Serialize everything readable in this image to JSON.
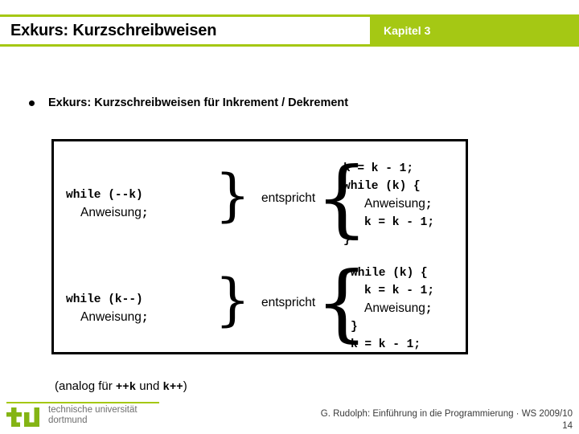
{
  "header": {
    "title": "Exkurs: Kurzschreibweisen",
    "chapter": "Kapitel 3",
    "accent_color": "#a5c814"
  },
  "bullet": {
    "marker": "bullet-dot",
    "text": "Exkurs: Kurzschreibweisen für Inkrement / Dekrement"
  },
  "equivalences": [
    {
      "left": {
        "lines": [
          {
            "text": "while (--k)",
            "style": "mono",
            "indent": 0
          },
          {
            "text": "Anweisung",
            "style": "sans",
            "indent": 1,
            "suffix": ";"
          }
        ]
      },
      "connector": "entspricht",
      "right": {
        "lines": [
          {
            "text": "k = k - 1;",
            "style": "mono",
            "indent": 0
          },
          {
            "text": "while (k) {",
            "style": "mono",
            "indent": 0
          },
          {
            "text": "Anweisung",
            "style": "sans",
            "indent": 1,
            "suffix": ";"
          },
          {
            "text": "k = k - 1;",
            "style": "mono",
            "indent": 1
          },
          {
            "text": "}",
            "style": "mono",
            "indent": 0
          }
        ]
      }
    },
    {
      "left": {
        "lines": [
          {
            "text": "while (k--)",
            "style": "mono",
            "indent": 0
          },
          {
            "text": "Anweisung",
            "style": "sans",
            "indent": 1,
            "suffix": ";"
          }
        ]
      },
      "connector": "entspricht",
      "right": {
        "lines": [
          {
            "text": "while (k) {",
            "style": "mono",
            "indent": 0
          },
          {
            "text": "k = k - 1;",
            "style": "mono",
            "indent": 1
          },
          {
            "text": "Anweisung",
            "style": "sans",
            "indent": 1,
            "suffix": ";"
          },
          {
            "text": "}",
            "style": "mono",
            "indent": 0
          },
          {
            "text": "k = k - 1;",
            "style": "mono",
            "indent": 0
          }
        ]
      }
    }
  ],
  "code_text": {
    "r1_left_l1": "while (--k)",
    "r1_left_l2": "Anweisung",
    "r1_left_l2_semi": ";",
    "r2_left_l1": "while (k--)",
    "r2_left_l2": "Anweisung",
    "r2_left_l2_semi": ";",
    "r1_right_l1": "k = k - 1;",
    "r1_right_l2": "while (k) {",
    "r1_right_l3": "Anweisung",
    "r1_right_l3_semi": ";",
    "r1_right_l4": "k = k - 1;",
    "r1_right_l5": "}",
    "r2_right_l1": "while (k) {",
    "r2_right_l2": "k = k - 1;",
    "r2_right_l3": "Anweisung",
    "r2_right_l3_semi": ";",
    "r2_right_l4": "}",
    "r2_right_l5": "k = k - 1;"
  },
  "connector_label": "entspricht",
  "analog_note": {
    "prefix": "(analog für ",
    "code1": "++k",
    "middle": " und ",
    "code2": "k++",
    "suffix": ")"
  },
  "footer": {
    "logo_mark": "tu",
    "logo_line1": "technische universität",
    "logo_line2": "dortmund",
    "credit": "G. Rudolph: Einführung in die Programmierung · WS 2009/10",
    "page": "14"
  }
}
